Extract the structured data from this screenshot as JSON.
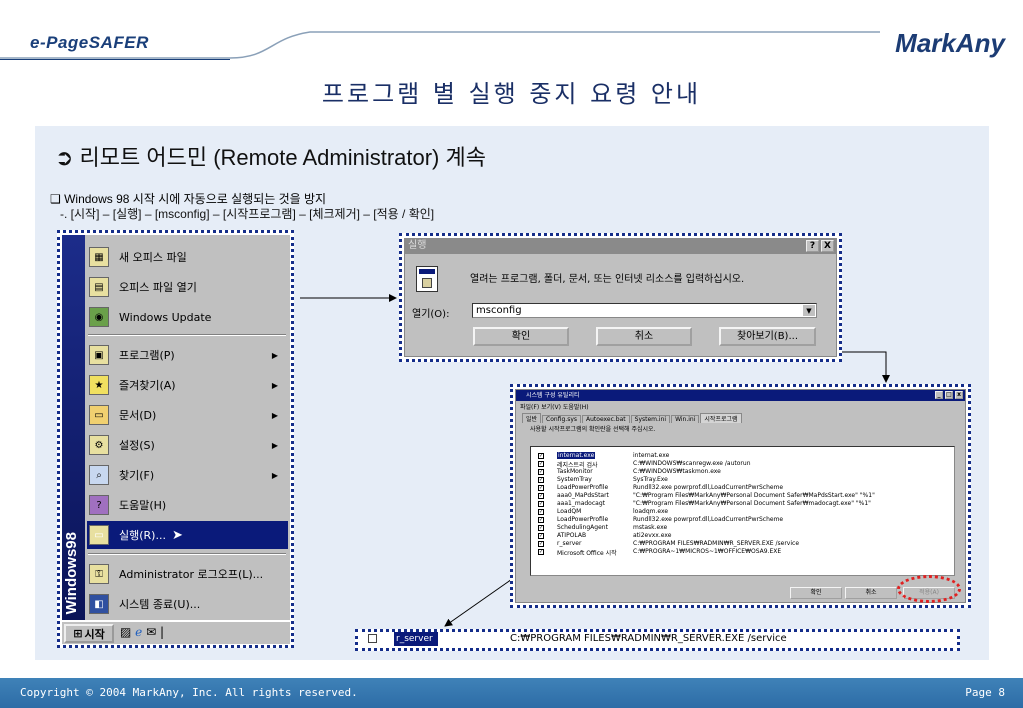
{
  "header": {
    "left_logo": "e-PageSAFER",
    "right_logo": "MarkAny",
    "title": "프로그램 별 실행 중지 요령 안내"
  },
  "section": {
    "heading": "➲ 리모트 어드민 (Remote Administrator) 계속",
    "bullet": "❑ Windows 98 시작 시에 자동으로 실행되는 것을 방지",
    "steps": "-. [시작] – [실행] – [msconfig] – [시작프로그램] – [체크제거] – [적용 / 확인]"
  },
  "start_menu": {
    "side_label": "Windows98",
    "items": [
      {
        "label": "새 오피스 파일",
        "icon": "office-new-icon"
      },
      {
        "label": "오피스 파일 열기",
        "icon": "office-open-icon"
      },
      {
        "label": "Windows Update",
        "icon": "windows-update-icon"
      },
      {
        "label": "프로그램(P)",
        "icon": "programs-icon",
        "submenu": true
      },
      {
        "label": "즐겨찾기(A)",
        "icon": "favorites-icon",
        "submenu": true
      },
      {
        "label": "문서(D)",
        "icon": "documents-icon",
        "submenu": true
      },
      {
        "label": "설정(S)",
        "icon": "settings-icon",
        "submenu": true
      },
      {
        "label": "찾기(F)",
        "icon": "find-icon",
        "submenu": true
      },
      {
        "label": "도움말(H)",
        "icon": "help-icon"
      },
      {
        "label": "실행(R)...",
        "icon": "run-icon",
        "selected": true
      },
      {
        "label": "Administrator 로그오프(L)...",
        "icon": "logoff-icon"
      },
      {
        "label": "시스템 종료(U)...",
        "icon": "shutdown-icon"
      }
    ],
    "start_button": "시작"
  },
  "run_dialog": {
    "title": "실행",
    "help_btn": "?",
    "close_btn": "X",
    "prompt": "열려는 프로그램, 폴더, 문서, 또는 인터넷 리소스를 입력하십시오.",
    "open_label": "열기(O):",
    "value": "msconfig",
    "ok": "확인",
    "cancel": "취소",
    "browse": "찾아보기(B)..."
  },
  "sysconfig": {
    "title": "시스템 구성 유틸리티",
    "menu": "파일(F)  보기(V)  도움말(H)",
    "tabs": [
      "일반",
      "Config.sys",
      "Autoexec.bat",
      "System.ini",
      "Win.ini",
      "시작프로그램"
    ],
    "description": "사용할 시작프로그램의 확인란을 선택해 주십시오.",
    "rows": [
      {
        "name": "internat.exe",
        "cmd": "internat.exe",
        "selected": true
      },
      {
        "name": "레지스트리 검사",
        "cmd": "C:₩WINDOWS₩scanregw.exe /autorun"
      },
      {
        "name": "TaskMonitor",
        "cmd": "C:₩WINDOWS₩taskmon.exe"
      },
      {
        "name": "SystemTray",
        "cmd": "SysTray.Exe"
      },
      {
        "name": "LoadPowerProfile",
        "cmd": "Rundll32.exe powrprof.dll,LoadCurrentPwrScheme"
      },
      {
        "name": "aaa0_MaPdsStart",
        "cmd": "\"C:₩Program Files₩MarkAny₩Personal Document Safer₩MaPdsStart.exe\" \"%1\""
      },
      {
        "name": "aaa1_madocagt",
        "cmd": "\"C:₩Program Files₩MarkAny₩Personal Document Safer₩madocagt.exe\" \"%1\""
      },
      {
        "name": "LoadQM",
        "cmd": "loadqm.exe"
      },
      {
        "name": "LoadPowerProfile",
        "cmd": "Rundll32.exe powrprof.dll,LoadCurrentPwrScheme"
      },
      {
        "name": "SchedulingAgent",
        "cmd": "mstask.exe"
      },
      {
        "name": "ATIPOLAB",
        "cmd": "ati2evxx.exe"
      },
      {
        "name": "r_server",
        "cmd": "C:₩PROGRAM FILES₩RADMIN₩R_SERVER.EXE /service"
      },
      {
        "name": "Microsoft Office 시작",
        "cmd": "C:₩PROGRA~1₩MICROS~1₩OFFICE₩OSA9.EXE"
      }
    ],
    "ok": "확인",
    "cancel": "취소",
    "apply": "적용(A)"
  },
  "strip": {
    "name": "r_server",
    "cmd": "C:₩PROGRAM FILES₩RADMIN₩R_SERVER.EXE /service"
  },
  "footer": {
    "copyright": "Copyright © 2004 MarkAny, Inc. All rights reserved.",
    "page": "Page 8"
  }
}
